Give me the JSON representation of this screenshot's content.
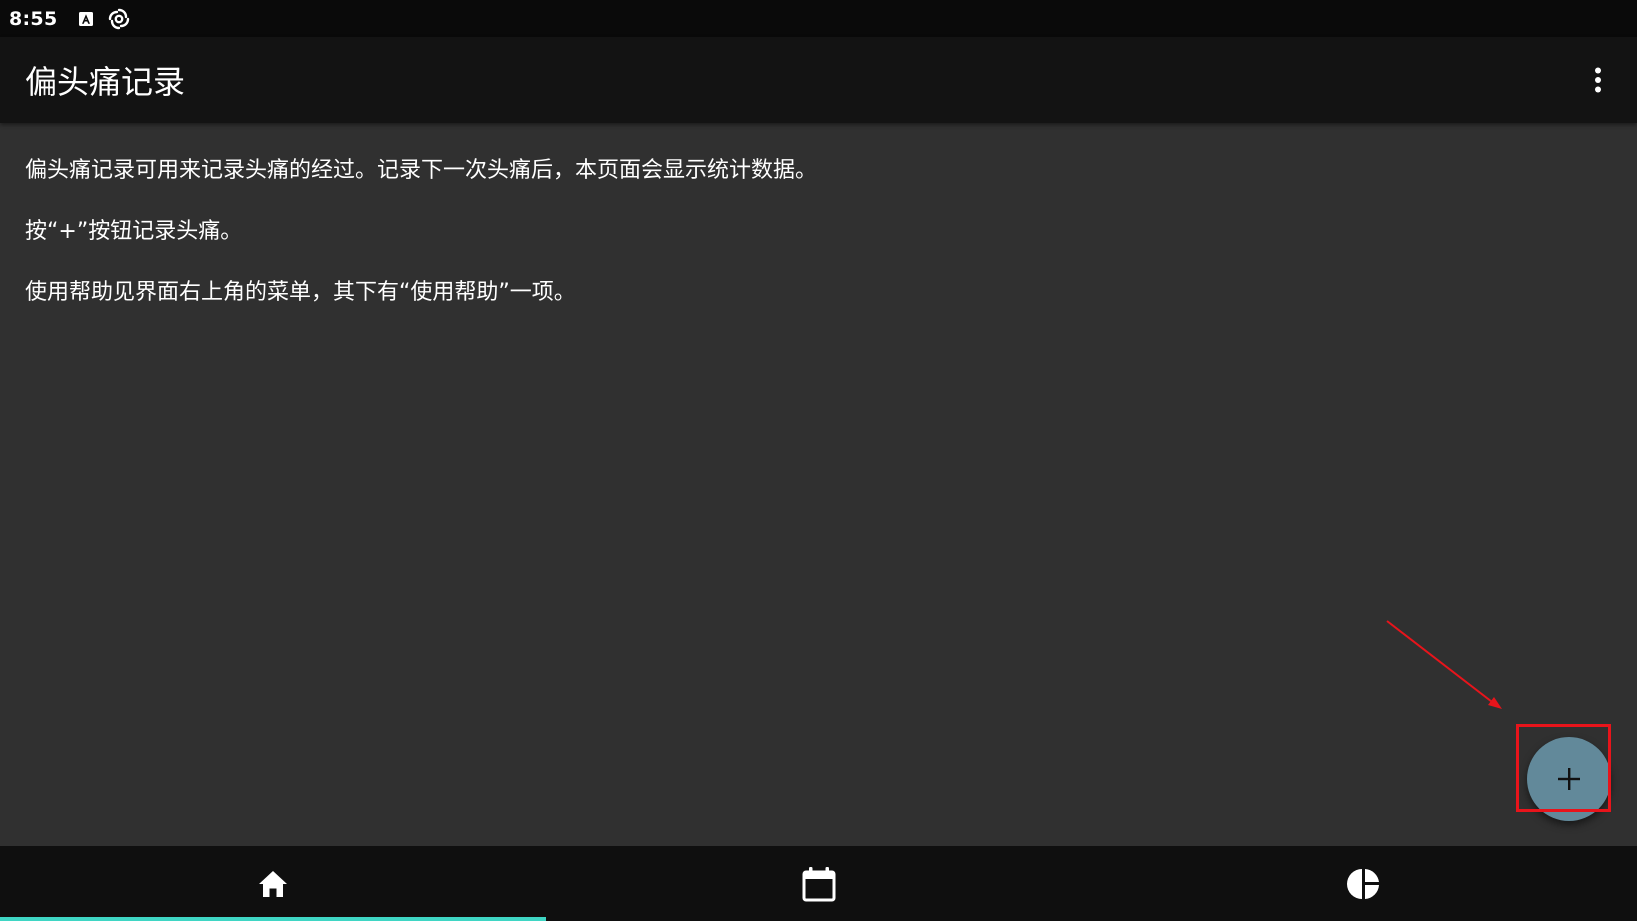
{
  "status_bar": {
    "time": "8:55",
    "icons": [
      "a-notification-icon",
      "sync-icon"
    ]
  },
  "app_bar": {
    "title": "偏头痛记录",
    "menu_icon": "more-vert-icon"
  },
  "content": {
    "paragraphs": [
      "偏头痛记录可用来记录头痛的经过。记录下一次头痛后，本页面会显示统计数据。",
      "按“+”按钮记录头痛。",
      "使用帮助见界面右上角的菜单，其下有“使用帮助”一项。"
    ]
  },
  "fab": {
    "icon": "plus-icon",
    "label": "+",
    "color": "#62899a"
  },
  "annotation": {
    "color": "#e8141b",
    "target": "fab"
  },
  "bottom_nav": {
    "items": [
      {
        "icon": "home-icon",
        "selected": true
      },
      {
        "icon": "calendar-icon",
        "selected": false
      },
      {
        "icon": "pie-chart-icon",
        "selected": false
      }
    ],
    "indicator_color": "#3fd6c4"
  },
  "colors": {
    "background": "#303030",
    "app_bar": "#131313",
    "status_bar": "#0a0a0a",
    "nav_bar": "#0f0f0f",
    "text": "#ffffff"
  }
}
